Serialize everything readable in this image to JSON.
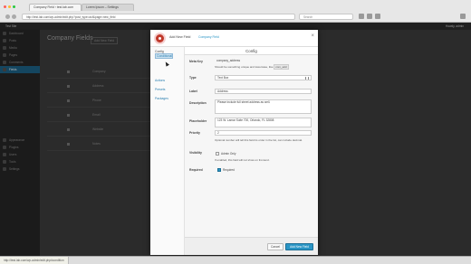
{
  "browser": {
    "tabs": [
      {
        "label": "Company Field ‹ test.lab.com"
      },
      {
        "label": "Lorem Ipsum – Settings"
      }
    ],
    "url": "http://test.lab.com/wp-admin/edit.php?post_type=acf&page=new_field",
    "search_placeholder": "Search"
  },
  "admin_bar": {
    "site": "Test Site",
    "howdy": "Howdy, admin"
  },
  "sidebar": {
    "items": [
      {
        "label": "Dashboard"
      },
      {
        "label": "Posts"
      },
      {
        "label": "Media"
      },
      {
        "label": "Pages"
      },
      {
        "label": "Comments"
      },
      {
        "label": "Fields"
      },
      {
        "label": "Appearance"
      },
      {
        "label": "Plugins"
      },
      {
        "label": "Users"
      },
      {
        "label": "Tools"
      },
      {
        "label": "Settings"
      }
    ]
  },
  "page": {
    "title": "Company Fields",
    "add_new": "Add New Field"
  },
  "rows": [
    {
      "label": "Company"
    },
    {
      "label": "Address"
    },
    {
      "label": "Phone"
    },
    {
      "label": "Email"
    },
    {
      "label": "Website"
    },
    {
      "label": "Notes"
    }
  ],
  "modal": {
    "title": "Add New Field",
    "subtitle": "Company Field",
    "close": "×",
    "nav": {
      "config": "Config",
      "condition": "Conditional",
      "actions": "Actions",
      "presets": "Presets",
      "packages": "Packages"
    },
    "section_title": "Config",
    "fields": {
      "meta_key_label": "Meta Key",
      "meta_key_value": "company_address",
      "meta_key_help": "Should be something unique and lowercase, like",
      "meta_key_help_code": "com_add",
      "type_label": "Type",
      "type_value": "Text Box",
      "label_label": "Label",
      "label_value": "Address",
      "description_label": "Description",
      "description_value": "Please include full street address as well.",
      "placeholder_label": "Placeholder",
      "placeholder_value": "123 W. Lamar Suite 700, Orlando, FL 32808",
      "priority_label": "Priority",
      "priority_value": "2",
      "priority_help": "Optional number will tell this field its order in the list, can include decimal.",
      "visibility_label": "Visibility",
      "visibility_option": "Admin Only",
      "visibility_help": "If enabled, this field will not show on frontend.",
      "required_label": "Required",
      "required_option": "Required"
    },
    "footer": {
      "cancel": "Cancel",
      "add_field": "Add New Field"
    }
  },
  "status_bar": {
    "url": "http://test.lab.com/wp-admin/edit.php#condition"
  }
}
